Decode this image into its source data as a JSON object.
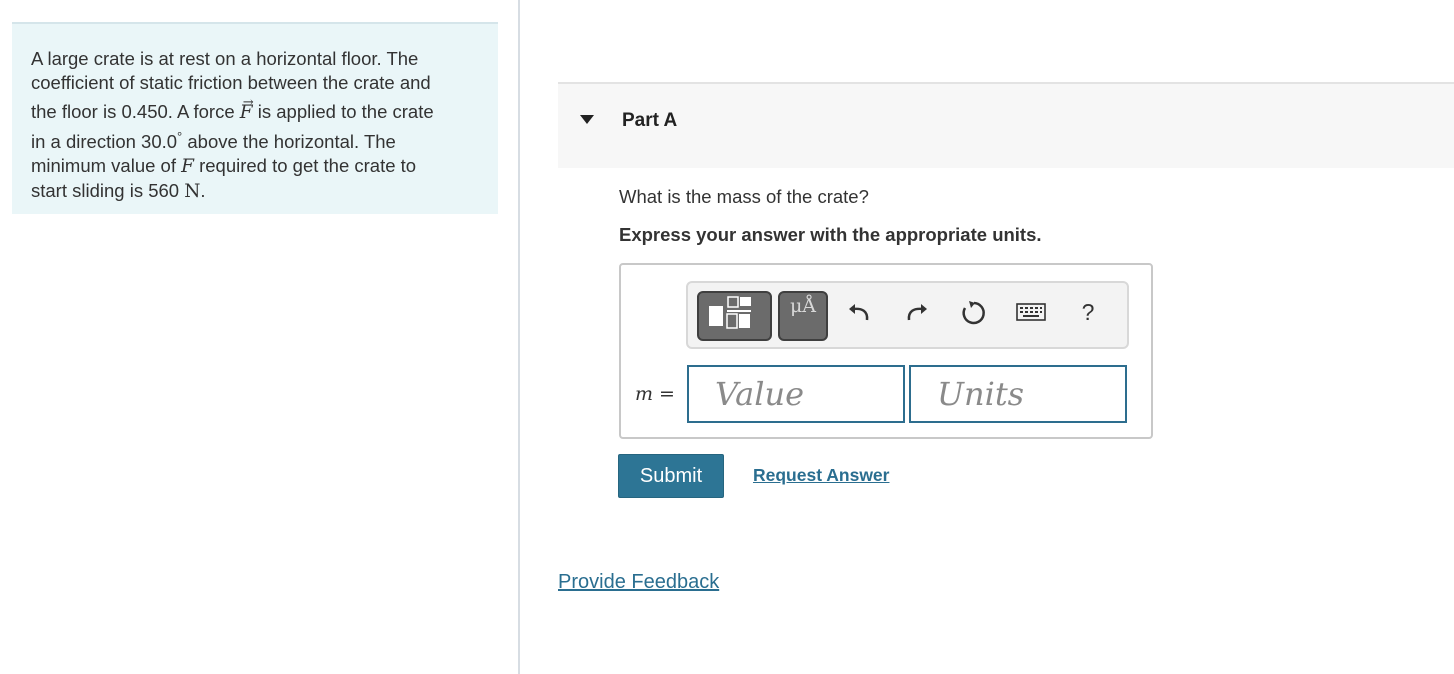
{
  "problem": {
    "line1": "A large crate is at rest on a horizontal floor. The",
    "line2": "coefficient of static friction between the crate and",
    "line3_a": "the floor is 0.450. A force ",
    "line3_var": "F",
    "line3_b": " is applied to the crate",
    "line4_a": "in a direction 30.0",
    "line4_deg": "°",
    "line4_b": " above the horizontal. The",
    "line5_a": "minimum value of ",
    "line5_var": "F",
    "line5_b": " required to get the crate to",
    "line6_a": "start sliding is 560 ",
    "line6_unit": "N",
    "line6_end": "."
  },
  "part": {
    "title": "Part A",
    "question": "What is the mass of the crate?",
    "instruction": "Express your answer with the appropriate units."
  },
  "answer": {
    "variable_label": "m =",
    "value_placeholder": "Value",
    "units_placeholder": "Units",
    "symbols_label": "μÅ",
    "help_label": "?"
  },
  "actions": {
    "submit_label": "Submit",
    "request_answer_label": "Request Answer",
    "feedback_label": "Provide Feedback"
  },
  "colors": {
    "accent": "#2d7595",
    "problem_bg": "#eaf6f8"
  },
  "icons": [
    "caret-down-icon",
    "templates-icon",
    "symbols-icon",
    "undo-icon",
    "redo-icon",
    "reset-icon",
    "keyboard-icon",
    "help-icon"
  ]
}
